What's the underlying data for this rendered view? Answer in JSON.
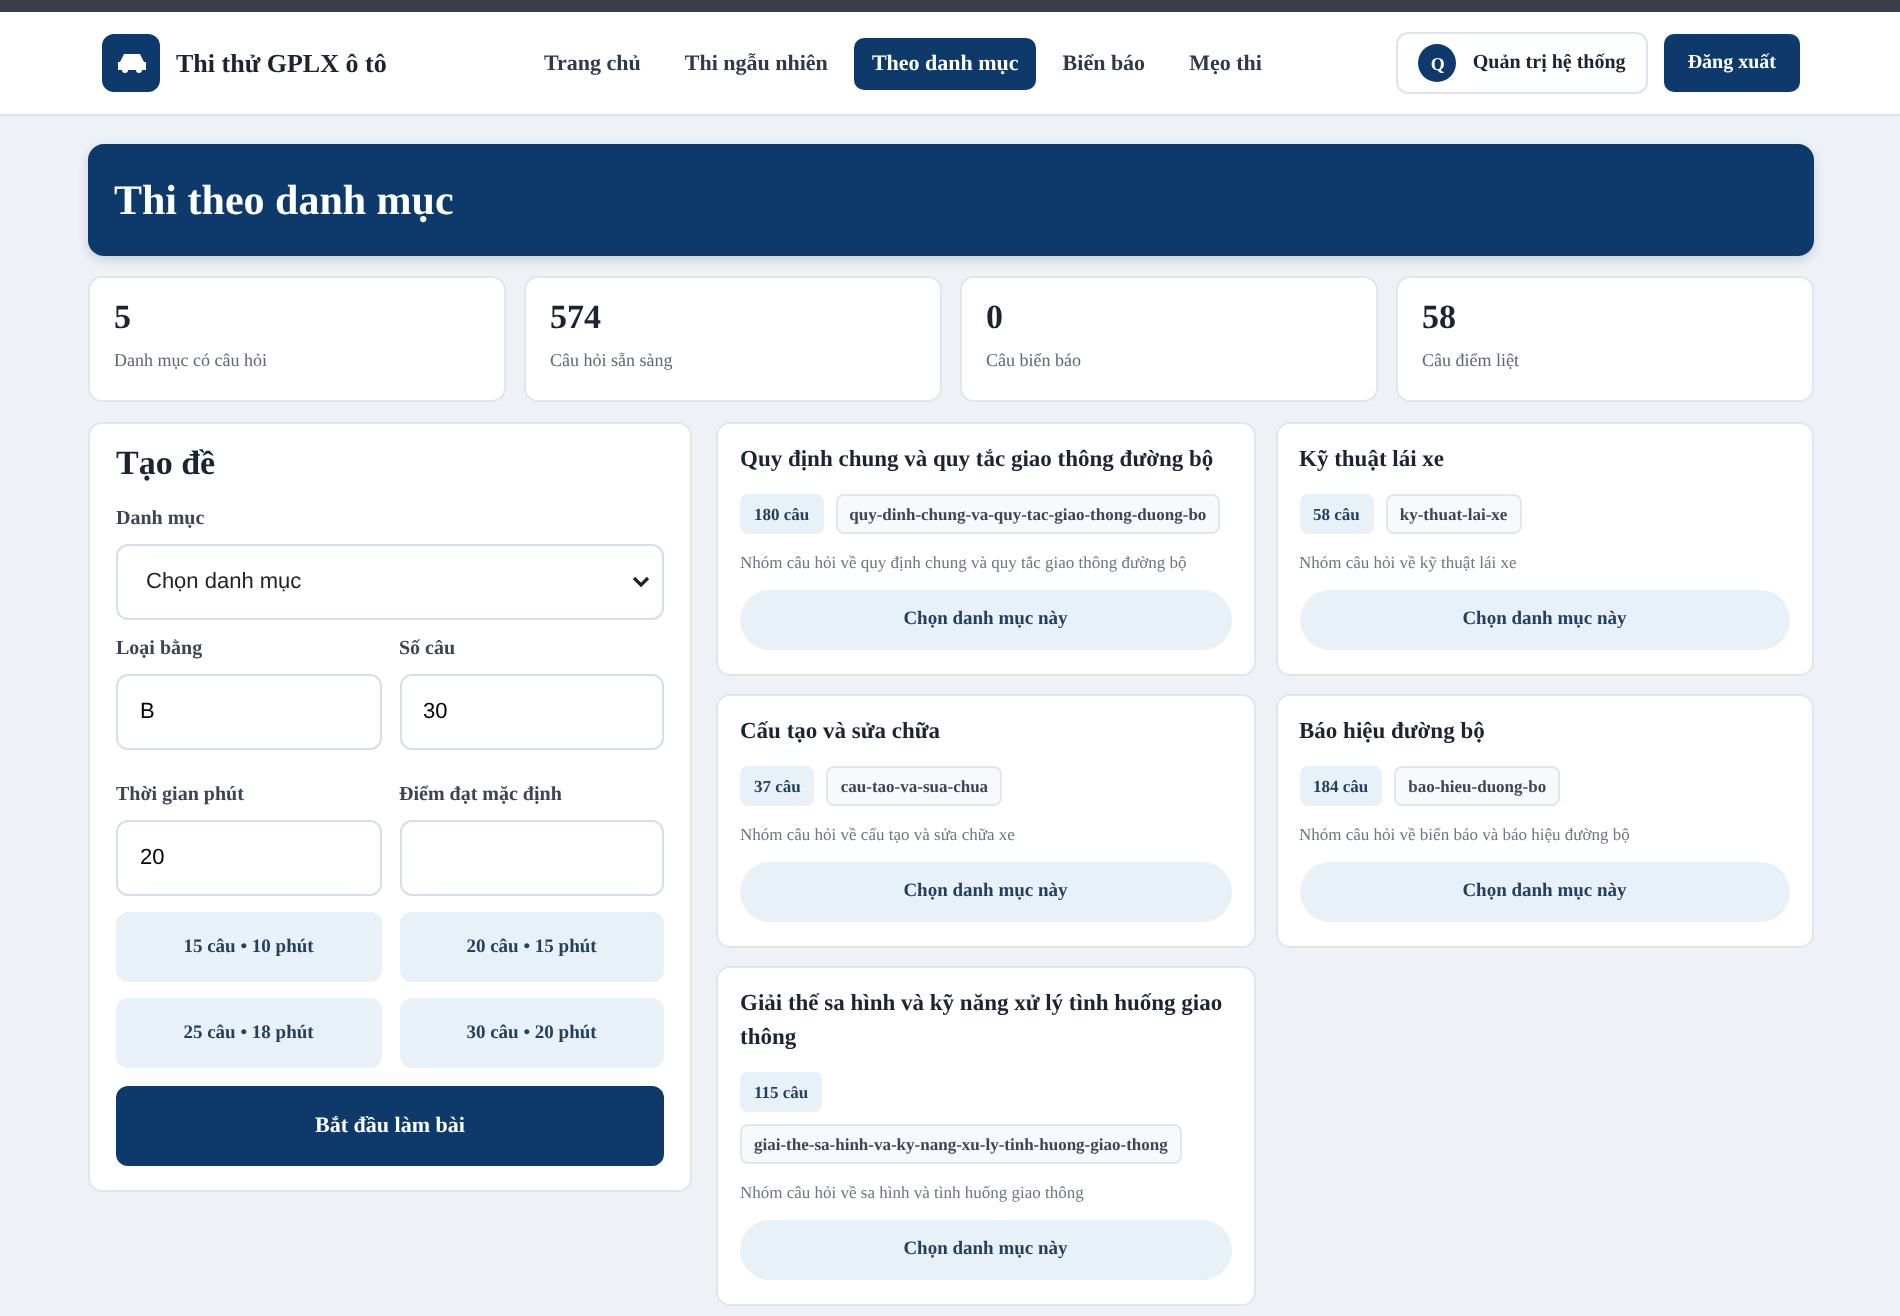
{
  "brand": {
    "title": "Thi thử GPLX ô tô"
  },
  "nav": [
    {
      "label": "Trang chủ",
      "selected": false
    },
    {
      "label": "Thi ngẫu nhiên",
      "selected": false
    },
    {
      "label": "Theo danh mục",
      "selected": true
    },
    {
      "label": "Biển báo",
      "selected": false
    },
    {
      "label": "Mẹo thi",
      "selected": false
    }
  ],
  "user": {
    "initial": "Q",
    "name": "Quản trị hệ thống"
  },
  "logout": "Đăng xuất",
  "banner": {
    "title": "Thi theo danh mục"
  },
  "stats": [
    {
      "value": "5",
      "label": "Danh mục có câu hỏi"
    },
    {
      "value": "574",
      "label": "Câu hỏi sẵn sàng"
    },
    {
      "value": "0",
      "label": "Câu biển báo"
    },
    {
      "value": "58",
      "label": "Câu điểm liệt"
    }
  ],
  "form": {
    "title": "Tạo đề",
    "category": {
      "label": "Danh mục",
      "value": "Chọn danh mục"
    },
    "fields": [
      {
        "label": "Loại bằng",
        "value": "B"
      },
      {
        "label": "Số câu",
        "value": "30"
      },
      {
        "label": "Thời gian phút",
        "value": "20"
      },
      {
        "label": "Điểm đạt mặc định"
      }
    ],
    "presets": [
      "15 câu • 10 phút",
      "20 câu • 15 phút",
      "25 câu • 18 phút",
      "30 câu • 20 phút"
    ],
    "submit": "Bắt đầu làm bài"
  },
  "categories": [
    {
      "title": "Quy định chung và quy tắc giao thông đường bộ",
      "count": "180 câu",
      "slug": "quy-dinh-chung-va-quy-tac-giao-thong-duong-bo",
      "description": "Nhóm câu hỏi về quy định chung và quy tắc giao thông đường bộ",
      "action": "Chọn danh mục này"
    },
    {
      "title": "Kỹ thuật lái xe",
      "count": "58 câu",
      "slug": "ky-thuat-lai-xe",
      "description": "Nhóm câu hỏi về kỹ thuật lái xe",
      "action": "Chọn danh mục này"
    },
    {
      "title": "Cấu tạo và sửa chữa",
      "count": "37 câu",
      "slug": "cau-tao-va-sua-chua",
      "description": "Nhóm câu hỏi về cấu tạo và sửa chữa xe",
      "action": "Chọn danh mục này"
    },
    {
      "title": "Báo hiệu đường bộ",
      "count": "184 câu",
      "slug": "bao-hieu-duong-bo",
      "description": "Nhóm câu hỏi về biển báo và báo hiệu đường bộ",
      "action": "Chọn danh mục này"
    },
    {
      "title": "Giải thế sa hình và kỹ năng xử lý tình huống giao thông",
      "count": "115 câu",
      "slug": "giai-the-sa-hinh-va-ky-nang-xu-ly-tinh-huong-giao-thong",
      "description": "Nhóm câu hỏi về sa hình và tình huống giao thông",
      "action": "Chọn danh mục này"
    }
  ]
}
